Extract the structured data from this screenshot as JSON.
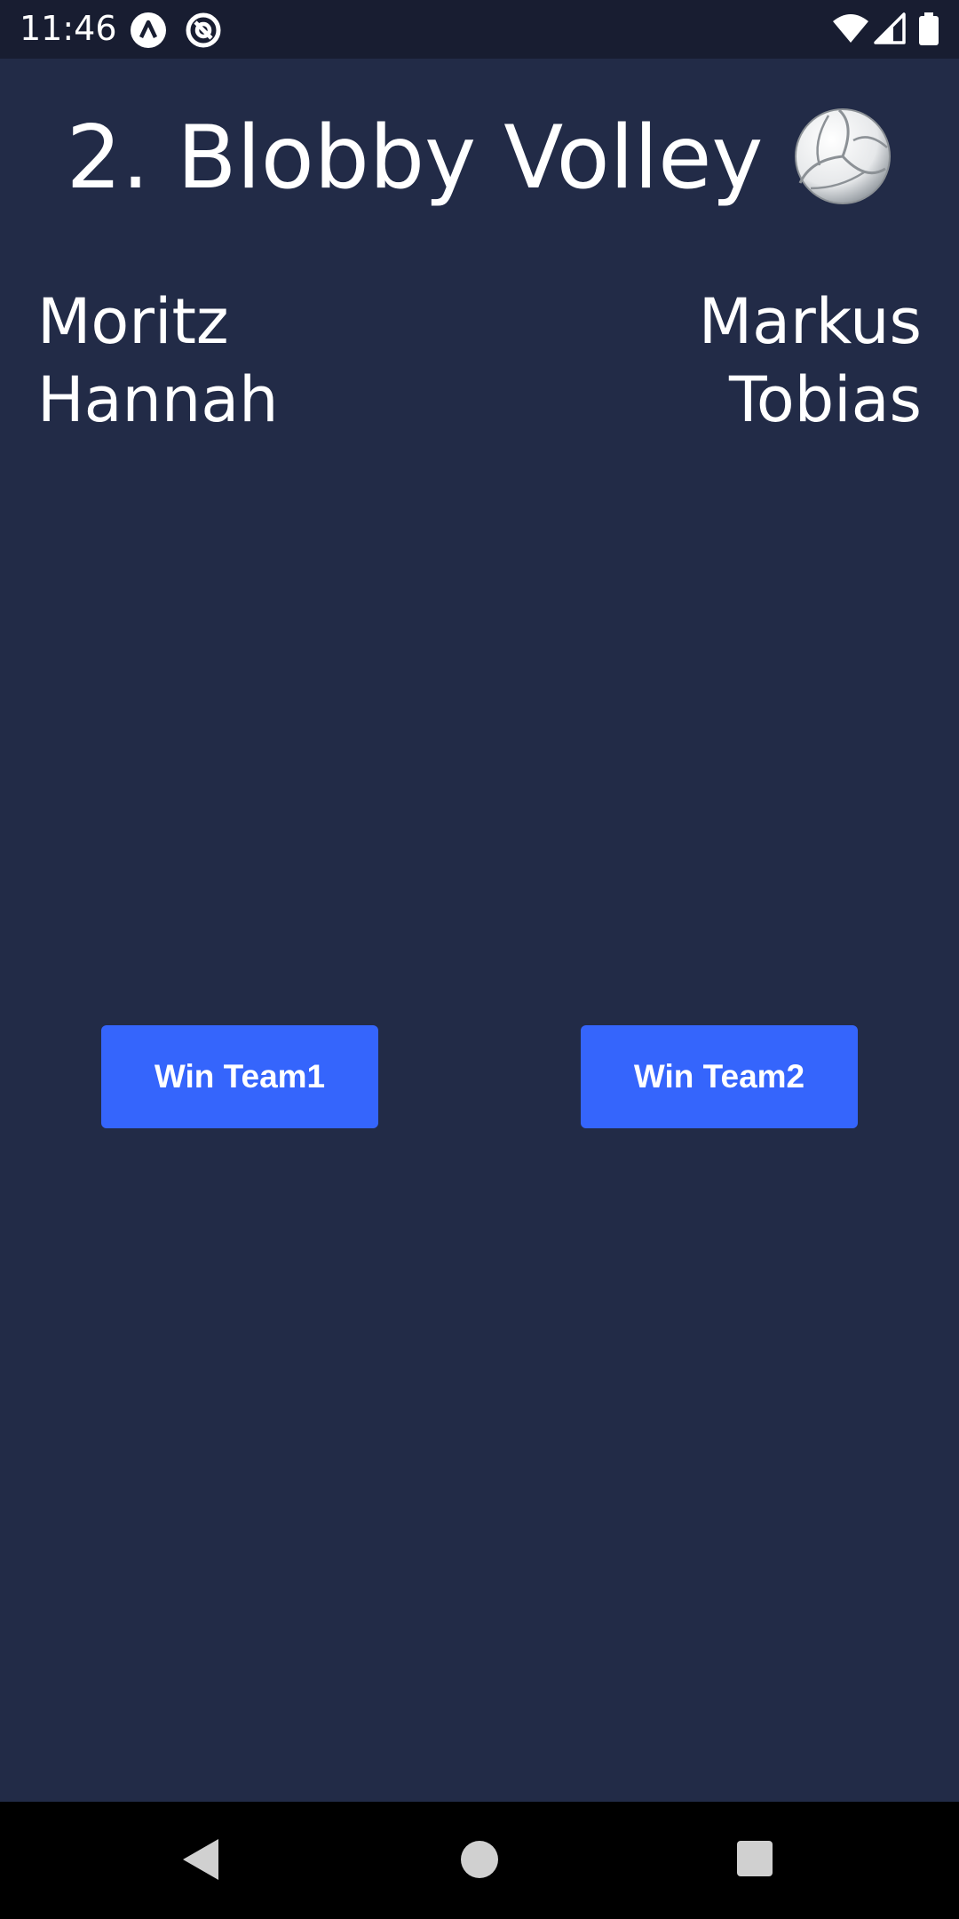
{
  "status_bar": {
    "time": "11:46",
    "icons": [
      "app-badge-icon",
      "at-sign-icon",
      "wifi-icon",
      "signal-icon",
      "battery-icon"
    ]
  },
  "header": {
    "title": "2. Blobby Volley",
    "icon": "volleyball-icon"
  },
  "team1": {
    "players": [
      "Moritz",
      "Hannah"
    ]
  },
  "team2": {
    "players": [
      "Markus",
      "Tobias"
    ]
  },
  "actions": {
    "win_team1_label": "Win Team1",
    "win_team2_label": "Win Team2"
  },
  "nav_bar": {
    "buttons": [
      "back-icon",
      "home-icon",
      "recents-icon"
    ]
  },
  "colors": {
    "background": "#222b47",
    "status_bar": "#181d31",
    "button": "#3565fc",
    "nav_bar": "#000000"
  }
}
